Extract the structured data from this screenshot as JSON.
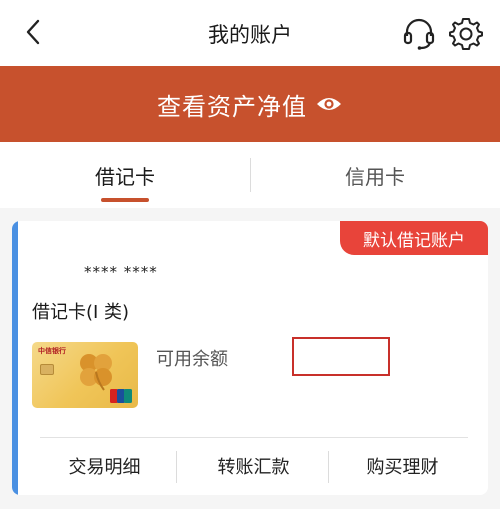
{
  "header": {
    "title": "我的账户",
    "back_icon": "chevron-left-icon",
    "service_icon": "headset-icon",
    "settings_icon": "gear-icon"
  },
  "banner": {
    "label": "查看资产净值",
    "icon": "eye-icon",
    "color": "#c7512d"
  },
  "tabs": [
    {
      "label": "借记卡",
      "active": true
    },
    {
      "label": "信用卡",
      "active": false
    }
  ],
  "account_card": {
    "badge": "默认借记账户",
    "account_number": "**** ****",
    "card_type": "借记卡(I 类)",
    "bank_name": "中信银行",
    "balance_label": "可用余额",
    "balance_value": "",
    "actions": [
      {
        "label": "交易明细"
      },
      {
        "label": "转账汇款"
      },
      {
        "label": "购买理财"
      }
    ]
  },
  "colors": {
    "accent": "#c7512d",
    "badge": "#e8443a",
    "card_border": "#4a90e2"
  }
}
